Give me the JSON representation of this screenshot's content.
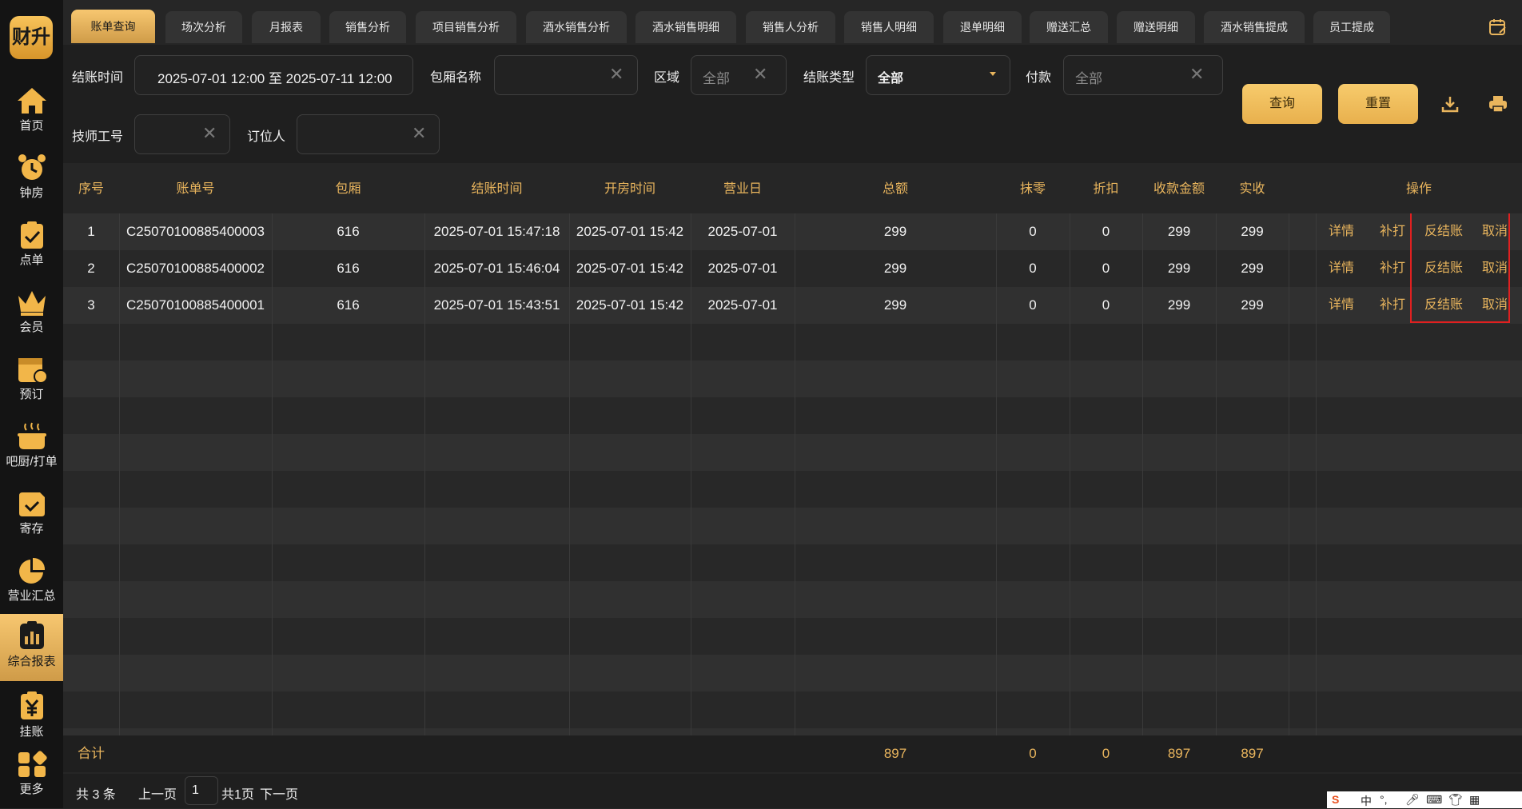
{
  "logo": "财升",
  "sidebar": {
    "items": [
      {
        "label": "首页"
      },
      {
        "label": "钟房"
      },
      {
        "label": "点单"
      },
      {
        "label": "会员"
      },
      {
        "label": "预订"
      },
      {
        "label": "吧厨/打单"
      },
      {
        "label": "寄存"
      },
      {
        "label": "营业汇总"
      },
      {
        "label": "综合报表",
        "active": true
      },
      {
        "label": "挂账"
      },
      {
        "label": "更多"
      }
    ]
  },
  "tabs": [
    {
      "label": "账单查询",
      "active": true
    },
    {
      "label": "场次分析"
    },
    {
      "label": "月报表"
    },
    {
      "label": "销售分析"
    },
    {
      "label": "项目销售分析"
    },
    {
      "label": "酒水销售分析"
    },
    {
      "label": "酒水销售明细"
    },
    {
      "label": "销售人分析"
    },
    {
      "label": "销售人明细"
    },
    {
      "label": "退单明细"
    },
    {
      "label": "赠送汇总"
    },
    {
      "label": "赠送明细"
    },
    {
      "label": "酒水销售提成"
    },
    {
      "label": "员工提成"
    }
  ],
  "filters": {
    "checkout_time_label": "结账时间",
    "checkout_time_value": "2025-07-01 12:00  至  2025-07-11 12:00",
    "room_name_label": "包厢名称",
    "room_name_value": "",
    "area_label": "区域",
    "area_value": "全部",
    "checkout_type_label": "结账类型",
    "checkout_type_value": "全部",
    "payment_label": "付款",
    "payment_value": "全部",
    "tech_id_label": "技师工号",
    "tech_id_value": "",
    "booker_label": "订位人",
    "booker_value": "",
    "query_btn": "查询",
    "reset_btn": "重置"
  },
  "table": {
    "headers": [
      "序号",
      "账单号",
      "包厢",
      "结账时间",
      "开房时间",
      "营业日",
      "总额",
      "抹零",
      "折扣",
      "收款金额",
      "实收",
      "",
      "操作"
    ],
    "rows": [
      [
        "1",
        "C25070100885400003",
        "616",
        "2025-07-01 15:47:18",
        "2025-07-01 15:42",
        "2025-07-01",
        "299",
        "0",
        "0",
        "299",
        "299"
      ],
      [
        "2",
        "C25070100885400002",
        "616",
        "2025-07-01 15:46:04",
        "2025-07-01 15:42",
        "2025-07-01",
        "299",
        "0",
        "0",
        "299",
        "299"
      ],
      [
        "3",
        "C25070100885400001",
        "616",
        "2025-07-01 15:43:51",
        "2025-07-01 15:42",
        "2025-07-01",
        "299",
        "0",
        "0",
        "299",
        "299"
      ]
    ],
    "row_actions": [
      "详情",
      "补打",
      "反结账",
      "取消"
    ],
    "totals": {
      "label": "合计",
      "total": "897",
      "rounding": "0",
      "discount": "0",
      "received": "897",
      "actual": "897"
    }
  },
  "pager": {
    "count_text": "共 3 条",
    "prev": "上一页",
    "page": "1",
    "total_pages": "共1页",
    "next": "下一页"
  },
  "ime": {
    "chars": [
      "中",
      "°,"
    ]
  },
  "colors": {
    "accent": "#e9b55d",
    "highlight_box": "#e02020"
  }
}
